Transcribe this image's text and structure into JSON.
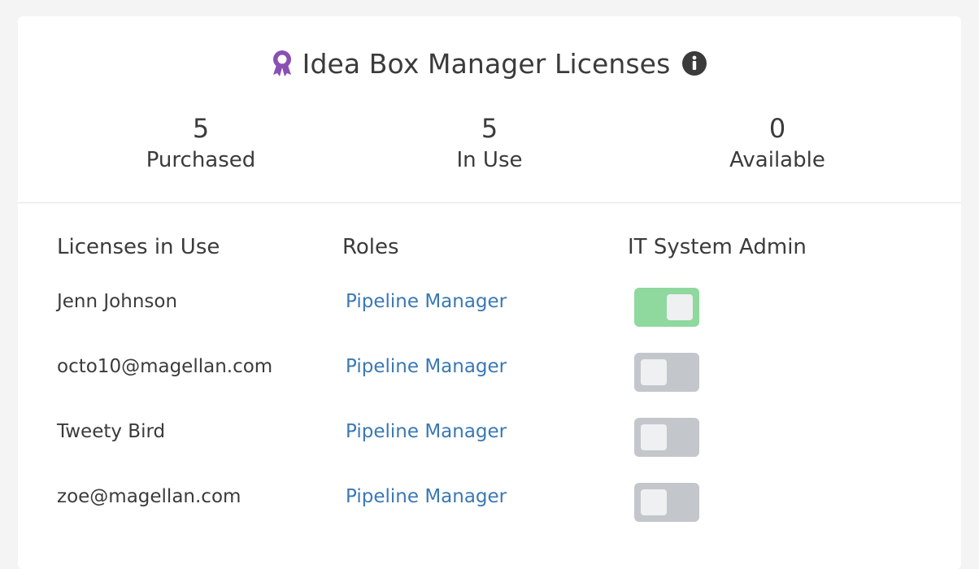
{
  "header": {
    "title": "Idea Box Manager Licenses",
    "icon": "award-ribbon-icon",
    "icon_color": "#8a4fb5",
    "info_icon": "info-icon"
  },
  "stats": [
    {
      "value": "5",
      "label": "Purchased"
    },
    {
      "value": "5",
      "label": "In Use"
    },
    {
      "value": "0",
      "label": "Available"
    }
  ],
  "table": {
    "columns": [
      "Licenses in Use",
      "Roles",
      "IT System Admin"
    ],
    "rows": [
      {
        "name": "Jenn Johnson",
        "role": "Pipeline Manager",
        "it_admin": true
      },
      {
        "name": "octo10@magellan.com",
        "role": "Pipeline Manager",
        "it_admin": false
      },
      {
        "name": "Tweety Bird",
        "role": "Pipeline Manager",
        "it_admin": false
      },
      {
        "name": "zoe@magellan.com",
        "role": "Pipeline Manager",
        "it_admin": false
      }
    ]
  },
  "colors": {
    "link": "#3a78b5",
    "toggle_on": "#8fd89e",
    "toggle_off": "#c3c7cb"
  }
}
